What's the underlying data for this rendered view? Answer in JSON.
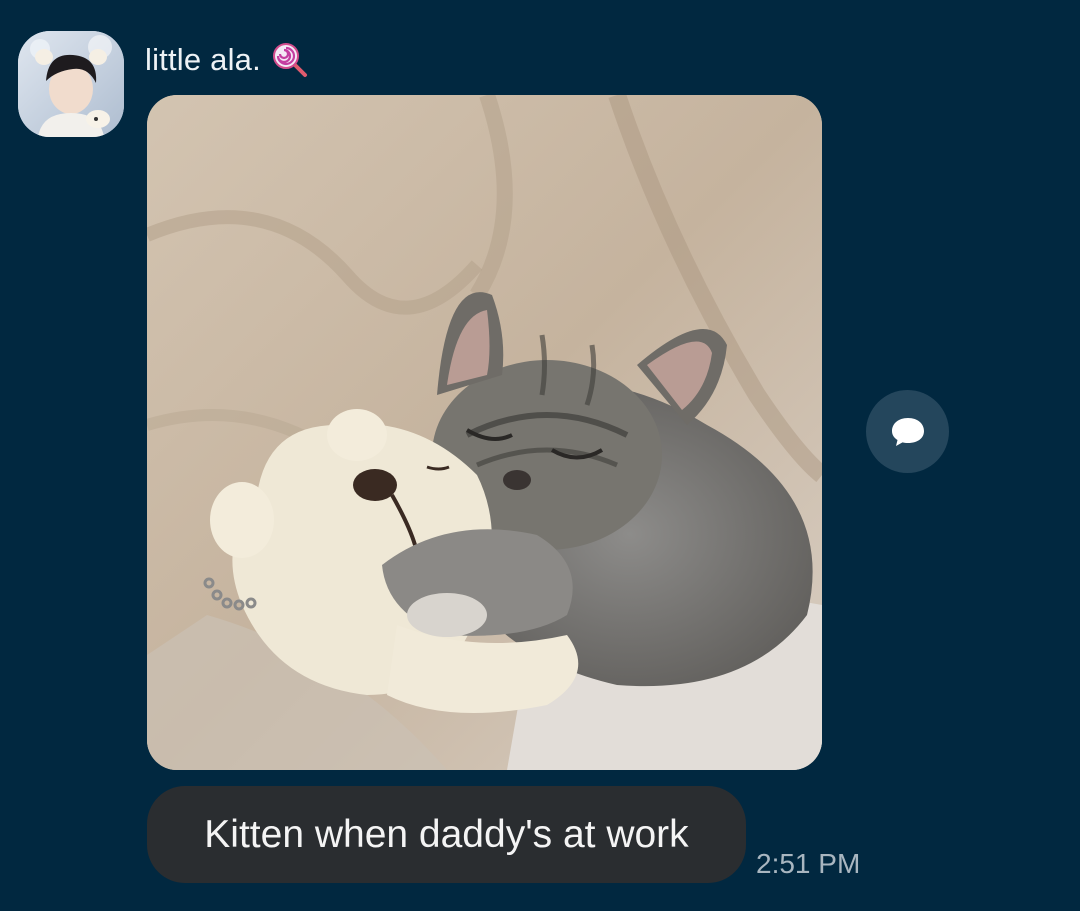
{
  "message": {
    "sender_name": "little ala.",
    "sender_emoji_icon": "lollipop-icon",
    "avatar_icon": "profile-avatar",
    "attachment_icon": "kitten-with-plush-photo",
    "text": "Kitten when daddy's at work",
    "timestamp": "2:51 PM"
  },
  "actions": {
    "reply_icon": "speech-bubble-icon"
  },
  "colors": {
    "background": "#012840",
    "bubble": "#2a2d30",
    "reply_button": "#24465c",
    "timestamp": "#a9b6c0"
  }
}
